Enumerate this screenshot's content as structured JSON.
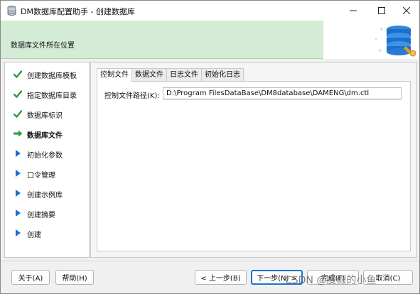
{
  "window": {
    "title": "DM数据库配置助手 - 创建数据库"
  },
  "banner": {
    "label": "数据库文件所在位置"
  },
  "steps": [
    {
      "label": "创建数据库模板",
      "state": "done"
    },
    {
      "label": "指定数据库目录",
      "state": "done"
    },
    {
      "label": "数据库标识",
      "state": "done"
    },
    {
      "label": "数据库文件",
      "state": "current"
    },
    {
      "label": "初始化参数",
      "state": "pending"
    },
    {
      "label": "口令管理",
      "state": "pending"
    },
    {
      "label": "创建示例库",
      "state": "pending"
    },
    {
      "label": "创建摘要",
      "state": "pending"
    },
    {
      "label": "创建",
      "state": "pending"
    }
  ],
  "tabs": [
    {
      "label": "控制文件",
      "active": true
    },
    {
      "label": "数据文件",
      "active": false
    },
    {
      "label": "日志文件",
      "active": false
    },
    {
      "label": "初始化日志",
      "active": false
    }
  ],
  "control_file": {
    "label": "控制文件路径(K):",
    "value": "D:\\Program FilesDataBase\\DM8database\\DAMENG\\dm.ctl"
  },
  "buttons": {
    "about": "关于(A)",
    "help": "帮助(H)",
    "prev": "< 上一步(B)",
    "next": "下一步(N) >",
    "finish": "完成(F)",
    "cancel": "取消(C)"
  },
  "watermark": "CSDN @度假的小鱼",
  "colors": {
    "banner_bg": "#d4ecd6",
    "check_green": "#2e9a3a",
    "arrow_green": "#2e9a3a",
    "pending_blue": "#1d6fcf",
    "primary_border": "#1f6fd1"
  }
}
